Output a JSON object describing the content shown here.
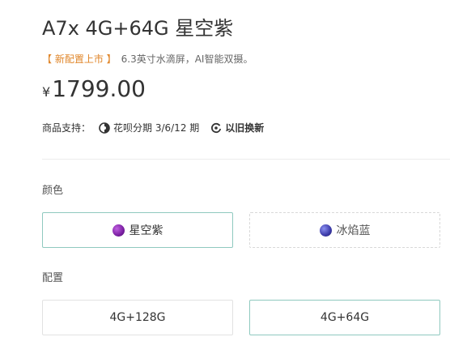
{
  "product": {
    "title": "A7x 4G+64G 星空紫",
    "promo_tag": "【 新配置上市 】",
    "promo_text": "6.3英寸水滴屏，AI智能双摄。",
    "currency": "¥",
    "price": "1799.00"
  },
  "support": {
    "label": "商品支持：",
    "items": [
      {
        "icon": "huabei-icon",
        "text": "花呗分期 3/6/12 期"
      },
      {
        "icon": "trade-in-icon",
        "text": "以旧换新"
      }
    ]
  },
  "color": {
    "label": "颜色",
    "options": [
      {
        "name": "星空紫",
        "swatch": "#7a1fa2",
        "selected": true
      },
      {
        "name": "冰焰蓝",
        "swatch": "#3b3aa8",
        "selected": false
      }
    ]
  },
  "config": {
    "label": "配置",
    "options": [
      {
        "name": "4G+128G",
        "selected": false
      },
      {
        "name": "4G+64G",
        "selected": true
      }
    ]
  },
  "colors": {
    "accent_border": "#8fc9bf",
    "promo_orange": "#e0862a"
  }
}
